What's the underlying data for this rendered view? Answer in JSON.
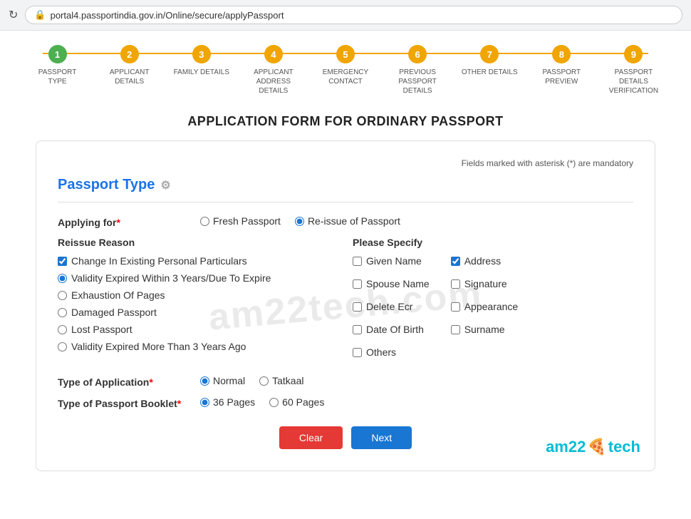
{
  "browser": {
    "url": "portal4.passportindia.gov.in/Online/secure/applyPassport",
    "reload_icon": "↻",
    "lock_icon": "🔒"
  },
  "steps": [
    {
      "number": "1",
      "label": "PASSPORT TYPE",
      "state": "completed"
    },
    {
      "number": "2",
      "label": "APPLICANT DETAILS",
      "state": "active"
    },
    {
      "number": "3",
      "label": "FAMILY DETAILS",
      "state": "active"
    },
    {
      "number": "4",
      "label": "APPLICANT ADDRESS DETAILS",
      "state": "active"
    },
    {
      "number": "5",
      "label": "EMERGENCY CONTACT",
      "state": "active"
    },
    {
      "number": "6",
      "label": "PREVIOUS PASSPORT DETAILS",
      "state": "active"
    },
    {
      "number": "7",
      "label": "OTHER DETAILS",
      "state": "active"
    },
    {
      "number": "8",
      "label": "PASSPORT PREVIEW",
      "state": "active"
    },
    {
      "number": "9",
      "label": "PASSPORT DETAILS VERIFICATION",
      "state": "active"
    }
  ],
  "page_title": "APPLICATION FORM FOR ORDINARY PASSPORT",
  "mandatory_note": "Fields marked with asterisk (*) are mandatory",
  "section_title": "Passport Type",
  "applying_for": {
    "label": "Applying for",
    "required": true,
    "options": [
      {
        "id": "fresh",
        "label": "Fresh Passport",
        "checked": false
      },
      {
        "id": "reissue",
        "label": "Re-issue of Passport",
        "checked": true
      }
    ]
  },
  "reissue_reason": {
    "title": "Reissue Reason",
    "options": [
      {
        "id": "change_personal",
        "label": "Change In Existing Personal Particulars",
        "checked": true,
        "type": "checkbox"
      },
      {
        "id": "validity_expired_3",
        "label": "Validity Expired Within 3 Years/Due To Expire",
        "checked": true,
        "type": "radio"
      },
      {
        "id": "exhaustion",
        "label": "Exhaustion Of Pages",
        "checked": false,
        "type": "radio"
      },
      {
        "id": "damaged",
        "label": "Damaged Passport",
        "checked": false,
        "type": "radio"
      },
      {
        "id": "lost",
        "label": "Lost Passport",
        "checked": false,
        "type": "radio"
      },
      {
        "id": "validity_expired_more",
        "label": "Validity Expired More Than 3 Years Ago",
        "checked": false,
        "type": "radio"
      }
    ]
  },
  "please_specify": {
    "title": "Please Specify",
    "col1": [
      {
        "id": "given_name",
        "label": "Given Name",
        "checked": false
      },
      {
        "id": "spouse_name",
        "label": "Spouse Name",
        "checked": false
      },
      {
        "id": "delete_ecr",
        "label": "Delete Ecr",
        "checked": false
      },
      {
        "id": "date_of_birth",
        "label": "Date Of Birth",
        "checked": false
      },
      {
        "id": "others",
        "label": "Others",
        "checked": false
      }
    ],
    "col2": [
      {
        "id": "address",
        "label": "Address",
        "checked": true
      },
      {
        "id": "signature",
        "label": "Signature",
        "checked": false
      },
      {
        "id": "appearance",
        "label": "Appearance",
        "checked": false
      },
      {
        "id": "surname",
        "label": "Surname",
        "checked": false
      }
    ]
  },
  "type_of_application": {
    "label": "Type of Application",
    "required": true,
    "options": [
      {
        "id": "normal",
        "label": "Normal",
        "checked": true
      },
      {
        "id": "tatkaal",
        "label": "Tatkaal",
        "checked": false
      }
    ]
  },
  "type_of_booklet": {
    "label": "Type of Passport Booklet",
    "required": true,
    "options": [
      {
        "id": "36pages",
        "label": "36 Pages",
        "checked": true
      },
      {
        "id": "60pages",
        "label": "60 Pages",
        "checked": false
      }
    ]
  },
  "buttons": {
    "clear": "Clear",
    "next": "Next"
  },
  "watermark": "am22tech.com",
  "branding": {
    "text_left": "am22",
    "emoji": "🍕",
    "text_right": "tech"
  }
}
